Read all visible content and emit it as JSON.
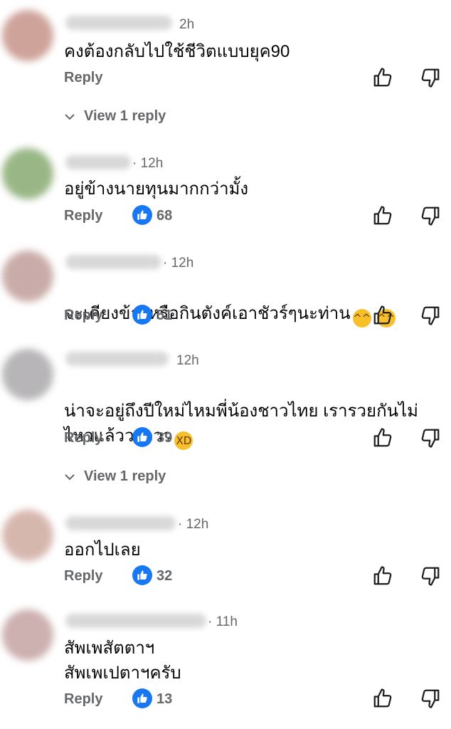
{
  "comments": [
    {
      "time": "2h",
      "text": "คงต้องกลับไปใช้ชีวิตแบบยุค90",
      "reply_label": "Reply",
      "likes": "",
      "view_replies": "View 1 reply",
      "avatar_color": "#c99a90"
    },
    {
      "time": "· 12h",
      "text": "อยู่ข้างนายทุนมากกว่ามั้ง",
      "reply_label": "Reply",
      "likes": "68",
      "view_replies": "",
      "avatar_color": "#8fb07a"
    },
    {
      "time": "· 12h",
      "text": "จะเคียงข้างหรือกินตังค์เอาชัวร์ๆนะท่าน",
      "emoji": "😆 😆",
      "reply_label": "Reply",
      "likes": "51",
      "view_replies": "",
      "avatar_color": "#c4a4a0"
    },
    {
      "time": "12h",
      "text": "น่าจะอยู่ถึงปีใหม่ไหมพี่น้องชาวไทย เรารวยกันไม่\nไหวแล้วววววว",
      "emoji": "🤣",
      "reply_label": "Reply",
      "likes": "39",
      "view_replies": "View 1 reply",
      "avatar_color": "#b0aeb0"
    },
    {
      "time": "· 12h",
      "text": "ออกไปเลย",
      "reply_label": "Reply",
      "likes": "32",
      "view_replies": "",
      "avatar_color": "#d2b0a6"
    },
    {
      "time": "· 11h",
      "text": "สัพเพสัตตาฯ\nสัพเพเปตาฯครับ",
      "reply_label": "Reply",
      "likes": "13",
      "view_replies": "",
      "avatar_color": "#c8a8a8"
    }
  ],
  "icons": {
    "like": "thumbs-up-icon",
    "dislike": "thumbs-down-icon",
    "badge": "like-badge-icon",
    "expand": "chevron-down-icon"
  },
  "colors": {
    "accent": "#1877f2",
    "secondary_text": "#65676b",
    "primary_text": "#050505"
  }
}
